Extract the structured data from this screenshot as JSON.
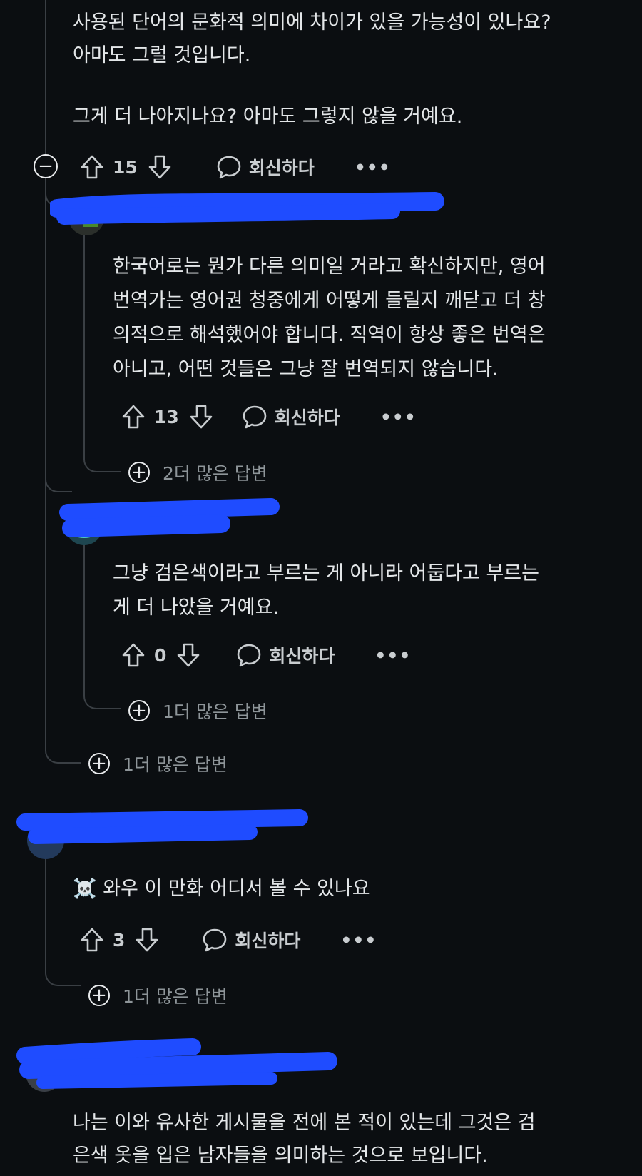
{
  "comment_top": {
    "lines": [
      "사용된 단어의 문화적 의미에 차이가 있을 가능성이 있나요?",
      "아마도 그럴 것입니다.",
      "그게 더 나아지나요? 아마도 그렇지 않을 거예요."
    ],
    "votes": "15",
    "reply_label": "회신하다",
    "more_label": "•••"
  },
  "reply_1": {
    "lines": [
      "한국어로는 뭔가 다른 의미일 거라고 확신하지만, 영어",
      "번역가는 영어권 청중에게 어떻게 들릴지 깨닫고 더 창",
      "의적으로 해석했어야 합니다. 직역이 항상 좋은 번역은",
      "아니고, 어떤 것들은 그냥 잘 번역되지 않습니다."
    ],
    "votes": "13",
    "reply_label": "회신하다",
    "more_label": "•••",
    "more_replies": "2더 많은 답변"
  },
  "reply_2": {
    "lines": [
      "그냥 검은색이라고 부르는 게 아니라 어둡다고 부르는",
      "게 더 나았을 거예요."
    ],
    "votes": "0",
    "reply_label": "회신하다",
    "more_label": "•••",
    "more_replies": "1더 많은 답변"
  },
  "thread_more_replies": "1더 많은 답변",
  "comment_2": {
    "lines": [
      "☠️ 와우 이 만화 어디서 볼 수 있나요"
    ],
    "votes": "3",
    "reply_label": "회신하다",
    "more_label": "•••",
    "more_replies": "1더 많은 답변"
  },
  "comment_3": {
    "lines": [
      "나는 이와 유사한 게시물을 전에 본 적이 있는데 그것은 검",
      "은색 옷을 입은 남자들을 의미하는 것으로 보입니다."
    ]
  },
  "colors": {
    "background": "#0b0e11",
    "text": "#e3e6e8",
    "redaction": "#1f4cff",
    "thread_line": "#3a3f44"
  }
}
